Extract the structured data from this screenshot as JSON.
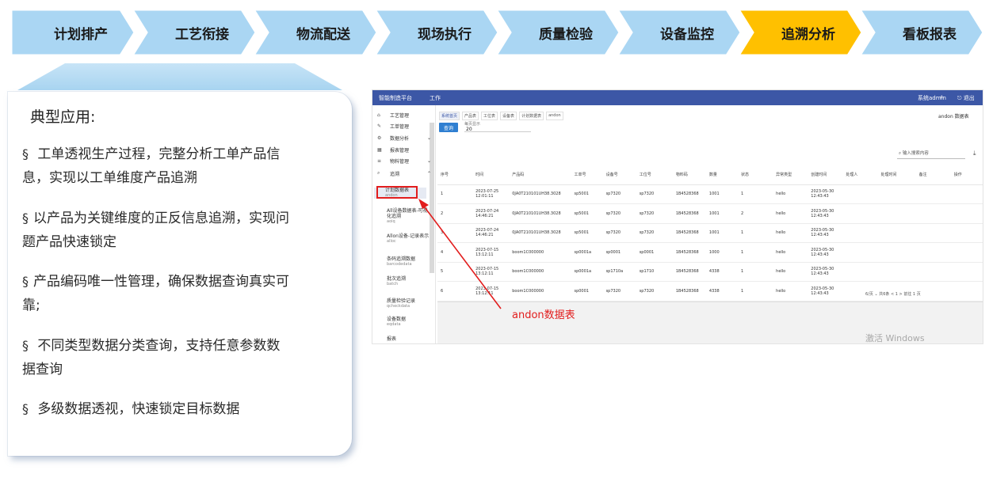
{
  "steps": [
    {
      "label": "计划排产",
      "active": false
    },
    {
      "label": "工艺衔接",
      "active": false
    },
    {
      "label": "物流配送",
      "active": false
    },
    {
      "label": "现场执行",
      "active": false
    },
    {
      "label": "质量检验",
      "active": false
    },
    {
      "label": "设备监控",
      "active": false
    },
    {
      "label": "追溯分析",
      "active": true
    },
    {
      "label": "看板报表",
      "active": false
    }
  ],
  "colors": {
    "step_fill": "#aad6f3",
    "step_active": "#ffc000",
    "accent_red": "#e21d1d",
    "topbar": "#3c57a6"
  },
  "card": {
    "title": "典型应用:",
    "bullets": [
      {
        "mark": "§",
        "text": " 工单透视生产过程，完整分析工单产品信息，实现以工单维度产品追溯"
      },
      {
        "mark": "§",
        "text": "以产品为关键维度的正反信息追溯，实现问题产品快速锁定"
      },
      {
        "mark": "§",
        "text": "产品编码唯一性管理，确保数据查询真实可靠;"
      },
      {
        "mark": "§",
        "text": " 不同类型数据分类查询，支持任意参数数据查询"
      },
      {
        "mark": "§",
        "text": " 多级数据透视，快速锁定目标数据"
      }
    ]
  },
  "app": {
    "topbar": {
      "title": "智能制造平台",
      "module": "工作",
      "user": "系统admin",
      "search_icon": "search-icon",
      "logout": "退出"
    },
    "sidebar": {
      "menu": [
        {
          "icon": "⌂",
          "label": "工艺管理",
          "chevron": ""
        },
        {
          "icon": "✎",
          "label": "工单管理",
          "chevron": ""
        },
        {
          "icon": "⚙",
          "label": "数据分析",
          "chevron": "⌄"
        },
        {
          "icon": "▦",
          "label": "报表管理",
          "chevron": ""
        },
        {
          "icon": "≡",
          "label": "物料管理",
          "chevron": "⌄"
        },
        {
          "icon": "⌕",
          "label": "追溯",
          "chevron": "⌃"
        }
      ],
      "submenu": [
        {
          "label": "计划数据表",
          "en": "andon"
        },
        {
          "label": "All设备数据表-可视化追溯",
          "en": "aoiq"
        },
        {
          "label": "Allon设备-记录表示",
          "en": "alloc"
        },
        {
          "label": "条码追溯数据",
          "en": "barcodedata"
        },
        {
          "label": "批次追溯",
          "en": "batch"
        },
        {
          "label": "质量检验记录",
          "en": "qcheckdata"
        },
        {
          "label": "设备数据",
          "en": "eqdata"
        },
        {
          "label": "报表"
        }
      ]
    },
    "tabs": [
      "系统首页",
      "产品表",
      "工位表",
      "设备表",
      "计划数据表",
      "andon"
    ],
    "user_info": "andon 数据表",
    "query_button": "查询",
    "field": {
      "label": "每页显示",
      "value": "20"
    },
    "search_placeholder": "输入搜索内容",
    "columns": [
      "序号",
      "时间",
      "产品码",
      "工单号",
      "设备号",
      "工位号",
      "物料码",
      "数量",
      "状态",
      "异常类型",
      "创建时间",
      "处理人",
      "处理时间",
      "备注",
      "操作"
    ],
    "rows": [
      [
        "1",
        "2023-07-25 12:01:11",
        "0JA0T210101UH38.3028",
        "sp5001",
        "sp7320",
        "sp7320",
        "1B4528368",
        "1001",
        "1",
        "hello",
        "2023-05-30 12:43:43",
        "",
        "",
        "",
        ""
      ],
      [
        "2",
        "2023-07-24 14:46:21",
        "0JA0T210101UH38.3028",
        "sp5001",
        "sp7320",
        "sp7320",
        "1B4528368",
        "1001",
        "2",
        "hello",
        "2023-05-30 12:43:43",
        "",
        "",
        "",
        ""
      ],
      [
        "3",
        "2023-07-24 14:46:21",
        "0JA0T210101UH38.3028",
        "sp5001",
        "sp7320",
        "sp7320",
        "1B4528368",
        "1001",
        "1",
        "hello",
        "2023-05-30 12:43:43",
        "",
        "",
        "",
        ""
      ],
      [
        "4",
        "2023-07-15 13:12:11",
        "boom1C000000",
        "sp0001a",
        "sp0001",
        "sp0001",
        "1B4528368",
        "1000",
        "1",
        "hello",
        "2023-05-30 12:43:43",
        "",
        "",
        "",
        ""
      ],
      [
        "5",
        "2023-07-15 13:12:11",
        "boom1C000000",
        "sp0001a",
        "sp1710a",
        "sp1710",
        "1B4528368",
        "4338",
        "1",
        "hello",
        "2023-05-30 12:43:43",
        "",
        "",
        "",
        ""
      ],
      [
        "6",
        "2023-07-15 13:12:11",
        "boom1C000000",
        "sp0001",
        "sp7320",
        "sp7320",
        "1B4528368",
        "4338",
        "1",
        "hello",
        "2023-05-30 12:43:43",
        "",
        "",
        "",
        ""
      ]
    ],
    "pager": "6/页 ⌄   共6条   < 1 >   前往 1 页",
    "watermark": "激活 Windows"
  },
  "annotation": "andon数据表"
}
